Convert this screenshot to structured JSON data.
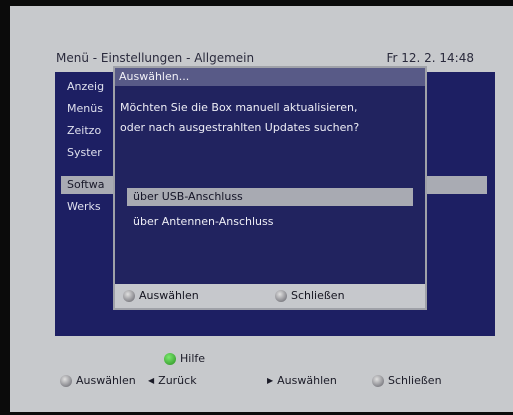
{
  "header": {
    "title": "Menü - Einstellungen - Allgemein",
    "datetime": "Fr 12. 2. 14:48"
  },
  "menu": {
    "items": [
      {
        "label": "Anzeig"
      },
      {
        "label": "Menüs"
      },
      {
        "label": "Zeitzo"
      },
      {
        "label": "Syster"
      },
      {
        "label": "Softwa"
      },
      {
        "label": "Werks"
      }
    ]
  },
  "dialog": {
    "title": "Auswählen...",
    "question_line1": "Möchten Sie die Box manuell aktualisieren,",
    "question_line2": "oder nach ausgestrahlten Updates suchen?",
    "options": [
      {
        "label": "über USB-Anschluss",
        "selected": true
      },
      {
        "label": "über Antennen-Anschluss",
        "selected": false
      }
    ],
    "footer": {
      "select": "Auswählen",
      "close": "Schließen"
    }
  },
  "bottom": {
    "help": "Hilfe",
    "select": "Auswählen",
    "back": "Zurück",
    "select_right": "Auswählen",
    "close": "Schließen"
  }
}
